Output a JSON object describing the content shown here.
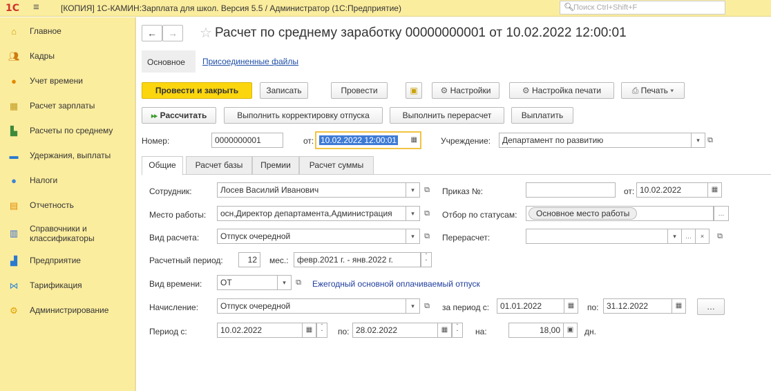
{
  "window": {
    "logo": "1С",
    "title": "[КОПИЯ] 1С-КАМИН:Зарплата для школ. Версия 5.5 / Администратор  (1С:Предприятие)",
    "search_placeholder": "Поиск Ctrl+Shift+F"
  },
  "sidebar": {
    "items": [
      {
        "label": "Главное",
        "icon": "home-icon",
        "color": "#c8a20a"
      },
      {
        "label": "Кадры",
        "icon": "people-icon",
        "color": "#d07a10"
      },
      {
        "label": "Учет времени",
        "icon": "clock-icon",
        "color": "#e08a00"
      },
      {
        "label": "Расчет зарплаты",
        "icon": "calculator-icon",
        "color": "#c09a20"
      },
      {
        "label": "Расчеты по среднему",
        "icon": "chart-icon",
        "color": "#3c8a3a"
      },
      {
        "label": "Удержания, выплаты",
        "icon": "wallet-icon",
        "color": "#2a7ad0"
      },
      {
        "label": "Налоги",
        "icon": "tax-icon",
        "color": "#3b84d6"
      },
      {
        "label": "Отчетность",
        "icon": "report-icon",
        "color": "#e08a00"
      },
      {
        "label": "Справочники и классификаторы",
        "icon": "books-icon",
        "color": "#3a6ad0"
      },
      {
        "label": "Предприятие",
        "icon": "factory-icon",
        "color": "#2a7ad0"
      },
      {
        "label": "Тарификация",
        "icon": "tariff-icon",
        "color": "#3a8ad0"
      },
      {
        "label": "Администрирование",
        "icon": "gears-icon",
        "color": "#e0a000"
      }
    ]
  },
  "document": {
    "title": "Расчет по среднему заработку 00000000001 от 10.02.2022 12:00:01",
    "tab_main": "Основное",
    "tab_files": "Присоединенные файлы"
  },
  "toolbar1": {
    "post_close": "Провести и закрыть",
    "save": "Записать",
    "post": "Провести",
    "settings": "Настройки",
    "print_settings": "Настройка печати",
    "print": "Печать"
  },
  "toolbar2": {
    "calculate": "Рассчитать",
    "adjust": "Выполнить корректировку отпуска",
    "recalc": "Выполнить перерасчет",
    "pay": "Выплатить"
  },
  "header": {
    "number_label": "Номер:",
    "number_value": "0000000001",
    "date_label": "от:",
    "date_value": "10.02.2022 12:00:01",
    "org_label": "Учреждение:",
    "org_value": "Департамент по развитию"
  },
  "subtabs": [
    "Общие",
    "Расчет базы",
    "Премии",
    "Расчет суммы"
  ],
  "form": {
    "employee_label": "Сотрудник:",
    "employee_value": "Лосев Василий Иванович",
    "order_label": "Приказ №:",
    "order_value": "",
    "order_date_label": "от:",
    "order_date_value": "10.02.2022",
    "workplace_label": "Место работы:",
    "workplace_value": "осн,Директор департамента,Администрация",
    "status_filter_label": "Отбор по статусам:",
    "status_filter_value": "Основное место работы",
    "calc_type_label": "Вид расчета:",
    "calc_type_value": "Отпуск очередной",
    "recalc_label": "Перерасчет:",
    "recalc_value": "",
    "period_label": "Расчетный период:",
    "period_months": "12",
    "months_label": "мес.:",
    "period_range": "февр.2021 г. - янв.2022 г.",
    "time_type_label": "Вид времени:",
    "time_type_value": "ОТ",
    "time_type_desc": "Ежегодный основной оплачиваемый отпуск",
    "accrual_label": "Начисление:",
    "accrual_value": "Отпуск очередной",
    "for_period_label": "за период с:",
    "for_period_from": "01.01.2022",
    "for_period_to_label": "по:",
    "for_period_to": "31.12.2022",
    "period_from_label": "Период с:",
    "period_from": "10.02.2022",
    "period_to_label": "по:",
    "period_to": "28.02.2022",
    "days_label": "на:",
    "days_value": "18,00",
    "days_unit": "дн."
  }
}
